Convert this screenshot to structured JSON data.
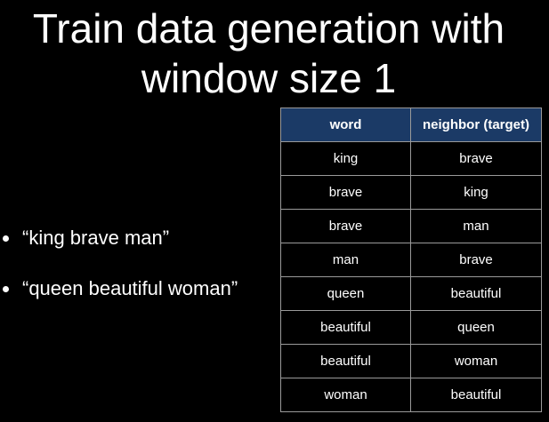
{
  "title": {
    "line1": "Train data generation with",
    "line2": "window size 1"
  },
  "bullets": [
    "“king brave man”",
    "“queen beautiful woman”"
  ],
  "table": {
    "headers": [
      "word",
      "neighbor (target)"
    ],
    "rows": [
      [
        "king",
        "brave"
      ],
      [
        "brave",
        "king"
      ],
      [
        "brave",
        "man"
      ],
      [
        "man",
        "brave"
      ],
      [
        "queen",
        "beautiful"
      ],
      [
        "beautiful",
        "queen"
      ],
      [
        "beautiful",
        "woman"
      ],
      [
        "woman",
        "beautiful"
      ]
    ]
  },
  "colors": {
    "background": "#000000",
    "header_bg": "#1b3a66",
    "text": "#ffffff",
    "grid": "#9a9a9a"
  }
}
